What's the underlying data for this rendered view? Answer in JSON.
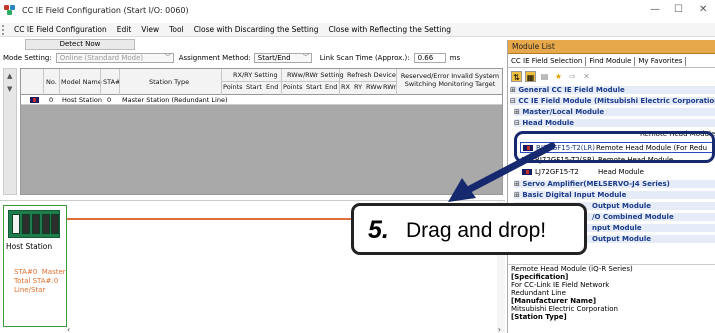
{
  "window": {
    "title": "CC IE Field Configuration (Start I/O: 0060)",
    "minimize": "—",
    "maximize": "☐",
    "close": "✕"
  },
  "menu": {
    "items": [
      "CC IE Field Configuration",
      "Edit",
      "View",
      "Tool",
      "Close with Discarding the Setting",
      "Close with Reflecting the Setting"
    ]
  },
  "toolbar": {
    "detect_now": "Detect Now",
    "mode_setting_label": "Mode Setting:",
    "mode_setting_value": "Online (Standard Mode)",
    "assignment_label": "Assignment Method:",
    "assignment_value": "Start/End",
    "scan_time_label": "Link Scan Time (Approx.):",
    "scan_time_value": "0.66",
    "scan_time_unit": "ms"
  },
  "table": {
    "headers": {
      "no": "No.",
      "model": "Model Name",
      "sta": "STA#",
      "station_type": "Station Type",
      "rxry": "RX/RY Setting",
      "rwwrwr": "RWw/RWr Setting",
      "refresh": "Refresh Device",
      "reserved": "Reserved/Error Invalid System Switching Monitoring Target",
      "points": "Points",
      "start": "Start",
      "end": "End",
      "rx": "RX",
      "ry": "RY",
      "rww": "RWw",
      "rwr": "RWr"
    },
    "rows": [
      {
        "no": "0",
        "model": "Host Station",
        "sta": "0",
        "station_type": "Master Station (Redundant Line)"
      }
    ]
  },
  "canvas": {
    "host_label": "Host Station",
    "host_info": "STA#0  Master\nTotal STA#:0\nLine/Star"
  },
  "module_list": {
    "title": "Module List",
    "tabs": [
      "CC IE Field Selection",
      "Find Module",
      "My Favorites"
    ],
    "tree": {
      "general": "General CC IE Field Module",
      "cc_ie_field": "CC IE Field Module (Mitsubishi Electric Corporation)",
      "master_local": "Master/Local Module",
      "head": "Head Module",
      "hidden_top_type": "Remote Head Module",
      "selected_model": "RJ72GF15-T2(LR)",
      "selected_type": "Remote Head Module (For Redu",
      "hidden_model": "RJ72GF15-T2(SR)",
      "hidden_type": "Remote Head Module",
      "lj_model": "LJ72GF15-T2",
      "lj_type": "Head Module",
      "servo": "Servo Amplifier(MELSERVO-J4 Series)",
      "basic_digital_input": "Basic Digital Input Module",
      "partial_output": "Output Module",
      "partial_io": "/O Combined Module",
      "partial_input": "nput Module",
      "partial_output2": "Output Module"
    },
    "description": {
      "line1": "Remote Head Module (iQ-R Series)",
      "spec_label": "[Specification]",
      "spec1": "For CC-Link IE Field Network",
      "spec2": "Redundant Line",
      "mfr_label": "[Manufacturer Name]",
      "mfr": "Mitsubishi Electric Corporation",
      "station_label": "[Station Type]"
    }
  },
  "callout": {
    "number": "5.",
    "text": "Drag and drop!"
  },
  "colors": {
    "accent_header": "#e6a84a",
    "tree_category": "#1a3a8a",
    "bus_line": "#e0703a",
    "host_border": "#3d9a3d",
    "highlight_frame": "#16286e"
  }
}
